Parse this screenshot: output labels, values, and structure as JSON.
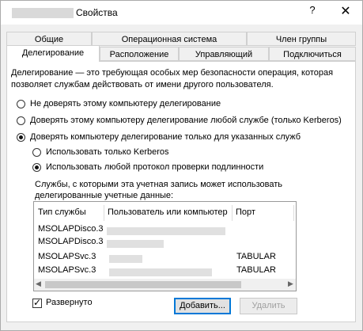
{
  "window": {
    "title": "Свойства",
    "help_glyph": "?",
    "close_glyph": "✕"
  },
  "tabs_row1": [
    {
      "label": "Общие"
    },
    {
      "label": "Операционная система"
    },
    {
      "label": "Член группы"
    }
  ],
  "tabs_row2": [
    {
      "label": "Делегирование",
      "active": true
    },
    {
      "label": "Расположение"
    },
    {
      "label": "Управляющий"
    },
    {
      "label": "Подключиться"
    }
  ],
  "delegation": {
    "description": "Делегирование — это требующая особых мер безопасности операция, которая позволяет службам действовать от имени другого пользователя.",
    "options": [
      {
        "label": "Не доверять этому компьютеру делегирование",
        "checked": false
      },
      {
        "label": "Доверять этому компьютеру делегирование любой службе (только Kerberos)",
        "checked": false
      },
      {
        "label": "Доверять компьютеру делегирование только для указанных служб",
        "checked": true
      }
    ],
    "sub_options": [
      {
        "label": "Использовать только Kerberos",
        "checked": false
      },
      {
        "label": "Использовать любой протокол проверки подлинности",
        "checked": true
      }
    ],
    "services_label": "Службы, с которыми эта учетная запись может использовать делегированные учетные данные:",
    "columns": [
      "Тип службы",
      "Пользователь или компьютер",
      "Порт"
    ],
    "rows": [
      {
        "service": "MSOLAPDisco.3",
        "user": "",
        "port": ""
      },
      {
        "service": "MSOLAPDisco.3",
        "user": "",
        "port": ""
      },
      {
        "service": "MSOLAPSvc.3",
        "user": "",
        "port": "TABULAR"
      },
      {
        "service": "MSOLAPSvc.3",
        "user": "",
        "port": "TABULAR"
      }
    ],
    "expanded_label": "Развернуто",
    "expanded_checked": true,
    "checkmark_glyph": "✓",
    "add_button": "Добавить...",
    "remove_button": "Удалить",
    "scroll_left_glyph": "◀",
    "scroll_right_glyph": "▶"
  }
}
